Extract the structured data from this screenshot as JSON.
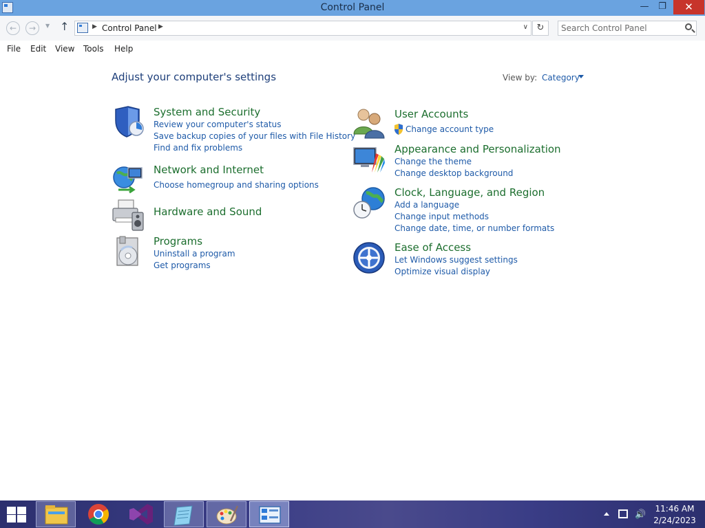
{
  "window": {
    "title": "Control Panel",
    "minimize_glyph": "—",
    "maximize_glyph": "❐",
    "close_glyph": "✕"
  },
  "address": {
    "breadcrumb": [
      "Control Panel"
    ],
    "search_placeholder": "Search Control Panel"
  },
  "menu": [
    "File",
    "Edit",
    "View",
    "Tools",
    "Help"
  ],
  "content": {
    "heading": "Adjust your computer's settings",
    "view_by_label": "View by:",
    "view_by_value": "Category",
    "categories": [
      {
        "title": "System and Security",
        "icon": "shield-icon",
        "links": [
          "Review your computer's status",
          "Save backup copies of your files with File History",
          "Find and fix problems"
        ]
      },
      {
        "title": "Network and Internet",
        "icon": "network-globe-icon",
        "links": [
          "Choose homegroup and sharing options"
        ]
      },
      {
        "title": "Hardware and Sound",
        "icon": "printer-speaker-icon",
        "links": []
      },
      {
        "title": "Programs",
        "icon": "programs-disc-icon",
        "links": [
          "Uninstall a program",
          "Get programs"
        ]
      },
      {
        "title": "User Accounts",
        "icon": "users-icon",
        "links": [
          "Change account type"
        ]
      },
      {
        "title": "Appearance and Personalization",
        "icon": "monitor-palette-icon",
        "links": [
          "Change the theme",
          "Change desktop background"
        ]
      },
      {
        "title": "Clock, Language, and Region",
        "icon": "clock-globe-icon",
        "links": [
          "Add a language",
          "Change input methods",
          "Change date, time, or number formats"
        ]
      },
      {
        "title": "Ease of Access",
        "icon": "ease-of-access-icon",
        "links": [
          "Let Windows suggest settings",
          "Optimize visual display"
        ]
      }
    ]
  },
  "taskbar": {
    "apps": [
      "file-explorer-icon",
      "chrome-icon",
      "visual-studio-icon",
      "notepad-icon",
      "paint-icon",
      "control-panel-icon"
    ],
    "time": "11:46 AM",
    "date": "2/24/2023"
  },
  "colors": {
    "title_bar": "#6aa3e0",
    "category_title": "#1c6e2e",
    "link": "#1e5aa8",
    "heading": "#1e3f7a",
    "close_button": "#c7342b"
  }
}
